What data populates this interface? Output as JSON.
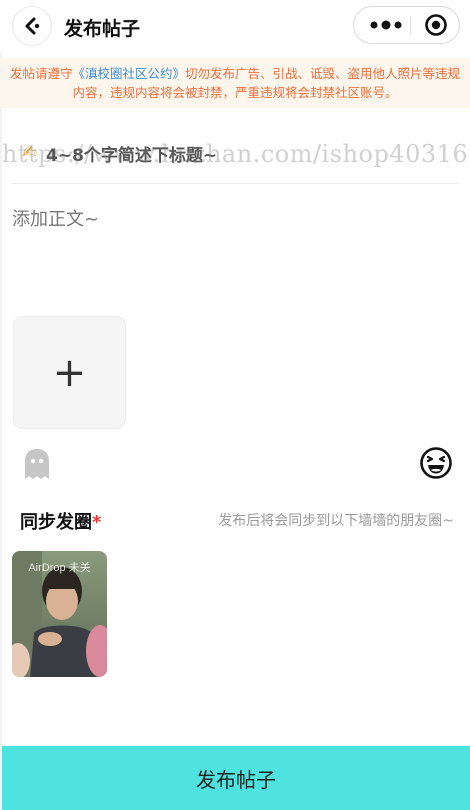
{
  "nav": {
    "title": "发布帖子"
  },
  "notice": {
    "text_before": "发帖请遵守",
    "link_text": "《滇校圈社区公约》",
    "text_after": "切勿发布广告、引战、诋毁、盗用他人照片等违规内容，违规内容将会被封禁，严重违规将会封禁社区账号。"
  },
  "post": {
    "title_placeholder": "4~8个字简述下标题~",
    "body_placeholder": "添加正文~"
  },
  "watermark": "https://www.huzhan.com/ishop40316",
  "uploader": {
    "add_symbol": "+"
  },
  "sync": {
    "label": "同步发圈",
    "required_mark": "*",
    "hint": "发布后将会同步到以下墙墙的朋友圈~",
    "card_caption": "AirDrop 未关"
  },
  "submit": {
    "label": "发布帖子"
  },
  "colors": {
    "accent": "#4fe3df",
    "notice_bg": "#fdf6ec",
    "notice_text": "#f06d3c",
    "link": "#3f8fd8",
    "required": "#e53935"
  },
  "icons": {
    "back": "chevron-left-icon",
    "more": "more-dots-icon",
    "capsule_close": "target-circle-icon",
    "title": "pencil-icon",
    "anonymous": "ghost-icon",
    "emoji": "laughing-face-icon"
  }
}
